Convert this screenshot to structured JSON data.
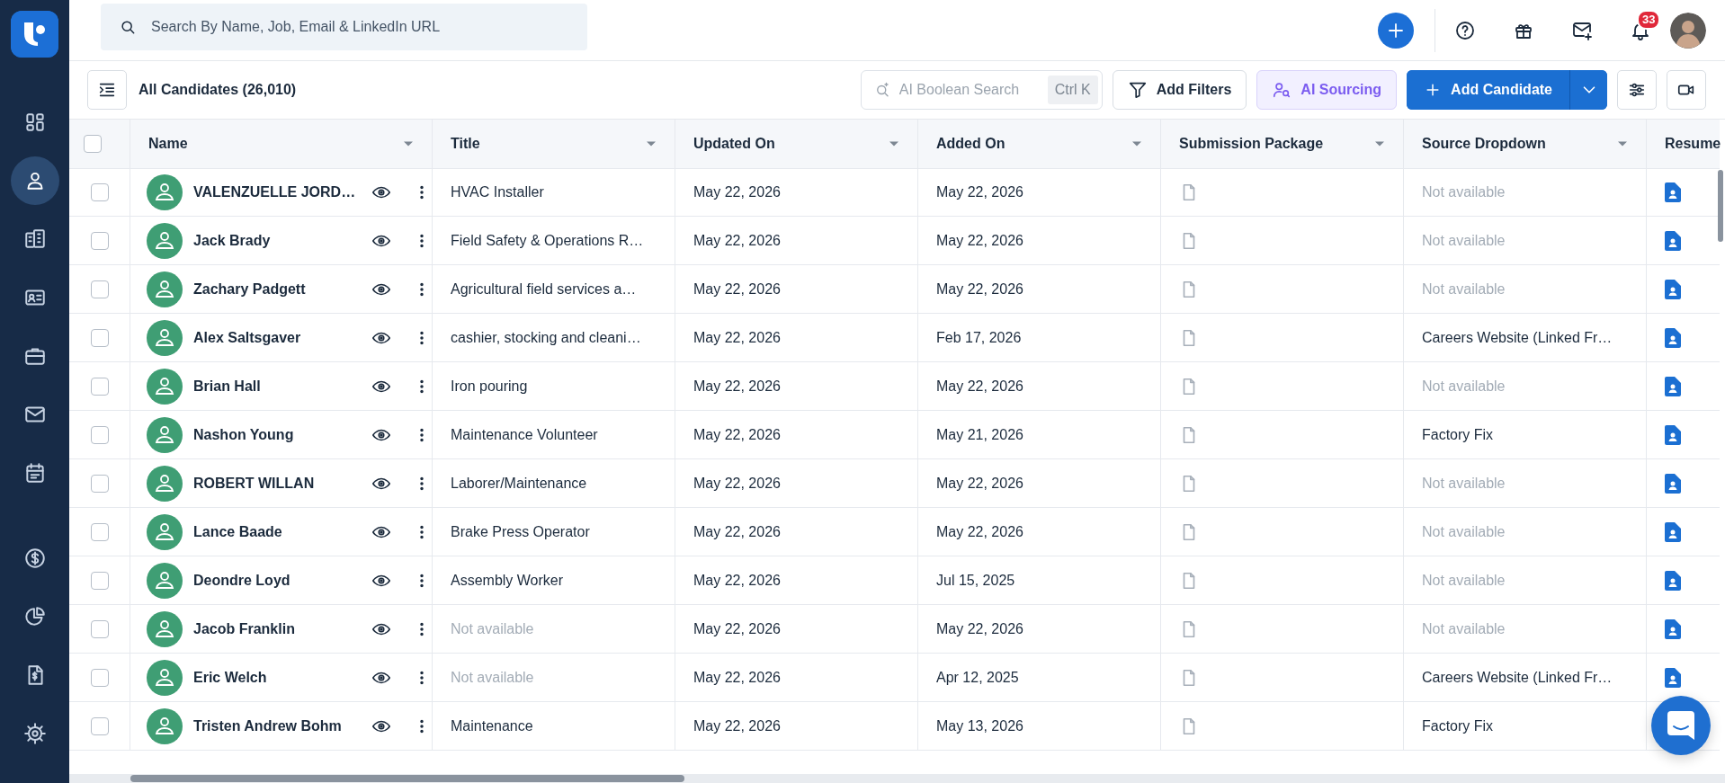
{
  "sidebar": {
    "items": [
      {
        "selected": false
      },
      {
        "selected": true
      },
      {
        "selected": false
      },
      {
        "selected": false
      },
      {
        "selected": false
      },
      {
        "selected": false
      },
      {
        "selected": false
      },
      {
        "selected": false
      },
      {
        "selected": false
      },
      {
        "selected": false
      },
      {
        "selected": false
      }
    ]
  },
  "topbar": {
    "search": {
      "placeholder": "Search By Name, Job, Email & LinkedIn URL"
    },
    "notifications": "33"
  },
  "toolbar": {
    "title": "All Candidates (26,010)",
    "ai_search": {
      "placeholder": "AI Boolean Search",
      "shortcut": "Ctrl K"
    },
    "buttons": [
      {
        "label": "Add Filters",
        "kind": "outline"
      },
      {
        "label": "AI Sourcing",
        "kind": "ai"
      },
      {
        "label": "Add Candidate",
        "kind": "primary"
      }
    ]
  },
  "table": {
    "select_all": {
      "checked": false
    },
    "columns": [
      "Name",
      "Title",
      "Updated On",
      "Added On",
      "Submission Package",
      "Source Dropdown",
      "Resume"
    ],
    "rows": [
      {
        "checked": false,
        "name": "VALENZUELLE JORD…",
        "title": "HVAC Installer",
        "title_muted": false,
        "updated_on": "May 22, 2026",
        "added_on": "May 22, 2026",
        "source": "Not available",
        "source_muted": true
      },
      {
        "checked": false,
        "name": "Jack Brady",
        "title": "Field Safety & Operations R…",
        "title_muted": false,
        "updated_on": "May 22, 2026",
        "added_on": "May 22, 2026",
        "source": "Not available",
        "source_muted": true
      },
      {
        "checked": false,
        "name": "Zachary Padgett",
        "title": "Agricultural field services a…",
        "title_muted": false,
        "updated_on": "May 22, 2026",
        "added_on": "May 22, 2026",
        "source": "Not available",
        "source_muted": true
      },
      {
        "checked": false,
        "name": "Alex Saltsgaver",
        "title": "cashier, stocking and cleani…",
        "title_muted": false,
        "updated_on": "May 22, 2026",
        "added_on": "Feb 17, 2026",
        "source": "Careers Website (Linked Fr…",
        "source_muted": false
      },
      {
        "checked": false,
        "name": "Brian Hall",
        "title": "Iron pouring",
        "title_muted": false,
        "updated_on": "May 22, 2026",
        "added_on": "May 22, 2026",
        "source": "Not available",
        "source_muted": true
      },
      {
        "checked": false,
        "name": "Nashon Young",
        "title": "Maintenance Volunteer",
        "title_muted": false,
        "updated_on": "May 22, 2026",
        "added_on": "May 21, 2026",
        "source": "Factory Fix",
        "source_muted": false
      },
      {
        "checked": false,
        "name": "ROBERT WILLAN",
        "title": "Laborer/Maintenance",
        "title_muted": false,
        "updated_on": "May 22, 2026",
        "added_on": "May 22, 2026",
        "source": "Not available",
        "source_muted": true
      },
      {
        "checked": false,
        "name": "Lance Baade",
        "title": "Brake Press Operator",
        "title_muted": false,
        "updated_on": "May 22, 2026",
        "added_on": "May 22, 2026",
        "source": "Not available",
        "source_muted": true
      },
      {
        "checked": false,
        "name": "Deondre Loyd",
        "title": "Assembly Worker",
        "title_muted": false,
        "updated_on": "May 22, 2026",
        "added_on": "Jul 15, 2025",
        "source": "Not available",
        "source_muted": true
      },
      {
        "checked": false,
        "name": "Jacob Franklin",
        "title": "Not available",
        "title_muted": true,
        "updated_on": "May 22, 2026",
        "added_on": "May 22, 2026",
        "source": "Not available",
        "source_muted": true
      },
      {
        "checked": false,
        "name": "Eric Welch",
        "title": "Not available",
        "title_muted": true,
        "updated_on": "May 22, 2026",
        "added_on": "Apr 12, 2025",
        "source": "Careers Website (Linked Fr…",
        "source_muted": false
      },
      {
        "checked": false,
        "name": "Tristen Andrew Bohm",
        "title": "Maintenance",
        "title_muted": false,
        "updated_on": "May 22, 2026",
        "added_on": "May 13, 2026",
        "source": "Factory Fix",
        "source_muted": false
      }
    ]
  }
}
